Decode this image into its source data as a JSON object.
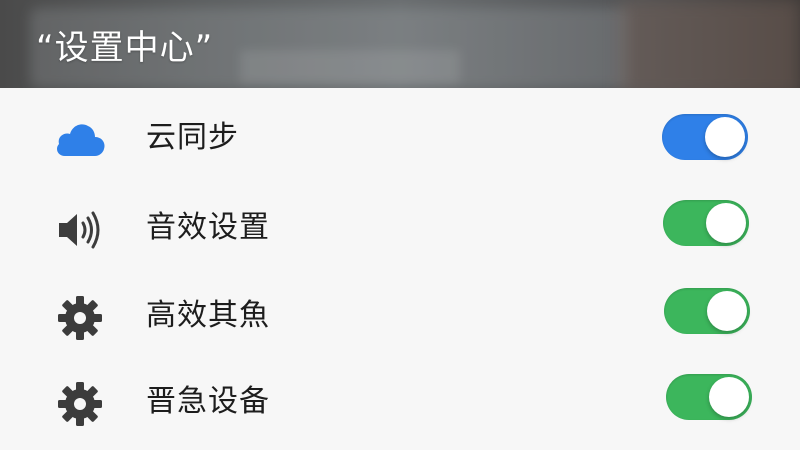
{
  "header": {
    "title": "“设置中心”"
  },
  "settings": {
    "items": [
      {
        "label": "云同步",
        "icon": "cloud-icon",
        "enabled": true,
        "toggle_color": "#2f80e8"
      },
      {
        "label": "音效设置",
        "icon": "speaker-icon",
        "enabled": true,
        "toggle_color": "#3cb65c"
      },
      {
        "label": "高效其魚",
        "icon": "gear-icon",
        "enabled": true,
        "toggle_color": "#3cb65c"
      },
      {
        "label": "晋急设备",
        "icon": "gear-icon",
        "enabled": true,
        "toggle_color": "#3cb65c"
      }
    ]
  },
  "colors": {
    "cloud_icon": "#2f80e8",
    "icon_dark": "#3c3c3c",
    "toggle_blue": "#2f80e8",
    "toggle_green": "#3cb65c"
  }
}
